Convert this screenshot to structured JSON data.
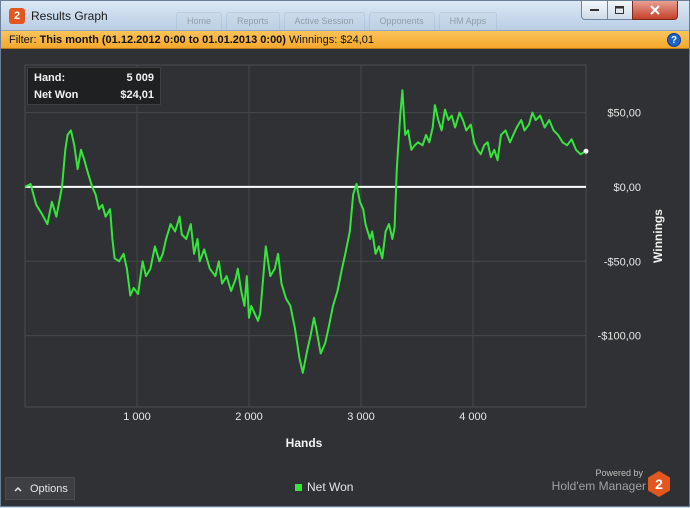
{
  "window": {
    "title": "Results Graph",
    "app_icon_glyph": "2",
    "background_tabs": [
      "Home",
      "Reports",
      "Active Session",
      "Opponents",
      "HM Apps"
    ]
  },
  "filter": {
    "prefix": "Filter:",
    "range": "This month (01.12.2012 0:00 to 01.01.2013 0:00)",
    "winnings": "Winnings: $24,01",
    "help_glyph": "?"
  },
  "info_box": {
    "hand_label": "Hand:",
    "hand_value": "5 009",
    "net_won_label": "Net Won",
    "net_won_value": "$24,01"
  },
  "chart_data": {
    "type": "line",
    "xlabel": "Hands",
    "ylabel": "Winnings",
    "x_ticks": [
      1000,
      2000,
      3000,
      4000
    ],
    "x_tick_labels": [
      "1 000",
      "2 000",
      "3 000",
      "4 000"
    ],
    "y_ticks": [
      50,
      0,
      -50,
      -100
    ],
    "y_tick_labels": [
      "$50,00",
      "$0,00",
      "-$50,00",
      "-$100,00"
    ],
    "xlim": [
      0,
      5009
    ],
    "ylim": [
      -148,
      82
    ],
    "grid": true,
    "zero_line": true,
    "line_color": "#35e53c",
    "zero_line_color": "#ffffff",
    "series": [
      {
        "name": "Net Won",
        "points": [
          [
            0,
            0
          ],
          [
            50,
            2
          ],
          [
            100,
            -12
          ],
          [
            150,
            -18
          ],
          [
            200,
            -25
          ],
          [
            240,
            -10
          ],
          [
            280,
            -20
          ],
          [
            330,
            0
          ],
          [
            360,
            25
          ],
          [
            380,
            35
          ],
          [
            410,
            38
          ],
          [
            440,
            28
          ],
          [
            470,
            12
          ],
          [
            500,
            25
          ],
          [
            530,
            18
          ],
          [
            560,
            10
          ],
          [
            600,
            0
          ],
          [
            630,
            -5
          ],
          [
            660,
            -15
          ],
          [
            690,
            -12
          ],
          [
            720,
            -20
          ],
          [
            760,
            -15
          ],
          [
            780,
            -35
          ],
          [
            800,
            -48
          ],
          [
            840,
            -50
          ],
          [
            880,
            -45
          ],
          [
            910,
            -55
          ],
          [
            940,
            -73
          ],
          [
            970,
            -68
          ],
          [
            1010,
            -72
          ],
          [
            1050,
            -50
          ],
          [
            1080,
            -60
          ],
          [
            1120,
            -55
          ],
          [
            1160,
            -40
          ],
          [
            1200,
            -50
          ],
          [
            1230,
            -45
          ],
          [
            1260,
            -35
          ],
          [
            1300,
            -25
          ],
          [
            1340,
            -30
          ],
          [
            1380,
            -20
          ],
          [
            1400,
            -32
          ],
          [
            1440,
            -35
          ],
          [
            1480,
            -25
          ],
          [
            1510,
            -45
          ],
          [
            1540,
            -35
          ],
          [
            1560,
            -50
          ],
          [
            1600,
            -42
          ],
          [
            1650,
            -55
          ],
          [
            1700,
            -60
          ],
          [
            1730,
            -50
          ],
          [
            1760,
            -65
          ],
          [
            1800,
            -60
          ],
          [
            1840,
            -70
          ],
          [
            1880,
            -62
          ],
          [
            1900,
            -55
          ],
          [
            1930,
            -70
          ],
          [
            1960,
            -80
          ],
          [
            1980,
            -60
          ],
          [
            2000,
            -88
          ],
          [
            2020,
            -80
          ],
          [
            2050,
            -85
          ],
          [
            2080,
            -90
          ],
          [
            2100,
            -85
          ],
          [
            2150,
            -40
          ],
          [
            2190,
            -60
          ],
          [
            2230,
            -55
          ],
          [
            2260,
            -45
          ],
          [
            2290,
            -65
          ],
          [
            2330,
            -75
          ],
          [
            2370,
            -80
          ],
          [
            2410,
            -95
          ],
          [
            2450,
            -115
          ],
          [
            2480,
            -125
          ],
          [
            2520,
            -110
          ],
          [
            2550,
            -100
          ],
          [
            2580,
            -88
          ],
          [
            2600,
            -95
          ],
          [
            2640,
            -112
          ],
          [
            2680,
            -105
          ],
          [
            2710,
            -95
          ],
          [
            2750,
            -80
          ],
          [
            2790,
            -70
          ],
          [
            2830,
            -55
          ],
          [
            2860,
            -45
          ],
          [
            2900,
            -30
          ],
          [
            2930,
            -5
          ],
          [
            2960,
            2
          ],
          [
            2990,
            -10
          ],
          [
            3020,
            -15
          ],
          [
            3040,
            -25
          ],
          [
            3080,
            -35
          ],
          [
            3100,
            -30
          ],
          [
            3130,
            -45
          ],
          [
            3160,
            -40
          ],
          [
            3190,
            -48
          ],
          [
            3220,
            -30
          ],
          [
            3250,
            -25
          ],
          [
            3280,
            -35
          ],
          [
            3300,
            -27
          ],
          [
            3320,
            12
          ],
          [
            3350,
            48
          ],
          [
            3370,
            65
          ],
          [
            3395,
            35
          ],
          [
            3420,
            38
          ],
          [
            3450,
            25
          ],
          [
            3480,
            28
          ],
          [
            3510,
            30
          ],
          [
            3550,
            28
          ],
          [
            3580,
            35
          ],
          [
            3610,
            30
          ],
          [
            3640,
            40
          ],
          [
            3660,
            55
          ],
          [
            3690,
            45
          ],
          [
            3720,
            38
          ],
          [
            3750,
            52
          ],
          [
            3780,
            45
          ],
          [
            3810,
            48
          ],
          [
            3840,
            40
          ],
          [
            3880,
            50
          ],
          [
            3910,
            45
          ],
          [
            3940,
            38
          ],
          [
            3980,
            42
          ],
          [
            4010,
            30
          ],
          [
            4040,
            25
          ],
          [
            4070,
            22
          ],
          [
            4100,
            28
          ],
          [
            4130,
            30
          ],
          [
            4160,
            20
          ],
          [
            4190,
            25
          ],
          [
            4220,
            18
          ],
          [
            4250,
            35
          ],
          [
            4290,
            38
          ],
          [
            4330,
            30
          ],
          [
            4360,
            35
          ],
          [
            4390,
            40
          ],
          [
            4430,
            45
          ],
          [
            4460,
            38
          ],
          [
            4500,
            42
          ],
          [
            4530,
            50
          ],
          [
            4560,
            45
          ],
          [
            4600,
            48
          ],
          [
            4640,
            40
          ],
          [
            4680,
            45
          ],
          [
            4720,
            38
          ],
          [
            4760,
            35
          ],
          [
            4800,
            30
          ],
          [
            4840,
            28
          ],
          [
            4880,
            32
          ],
          [
            4920,
            25
          ],
          [
            4960,
            22
          ],
          [
            5009,
            24
          ]
        ]
      }
    ],
    "legend": [
      "Net Won"
    ],
    "legend_position": "bottom-center"
  },
  "footer": {
    "options_label": "Options",
    "powered_by": "Powered by",
    "brand": "Hold'em Manager",
    "brand_glyph": "2"
  }
}
